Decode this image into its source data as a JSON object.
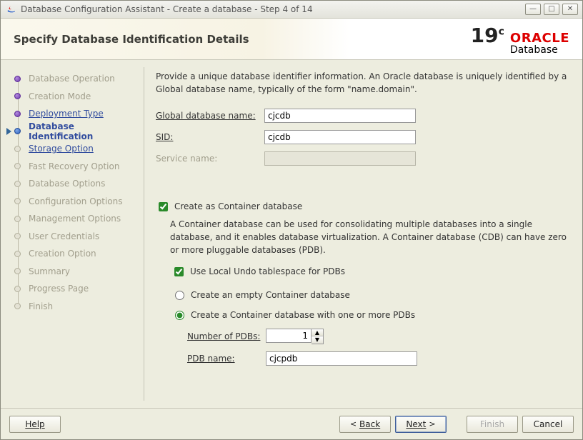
{
  "window": {
    "title": "Database Configuration Assistant - Create a database - Step 4 of 14"
  },
  "header": {
    "title": "Specify Database Identification Details",
    "brand_version": "19",
    "brand_suffix": "c",
    "brand_oracle": "ORACLE",
    "brand_db": "Database"
  },
  "steps": [
    {
      "label": "Database Operation",
      "state": "done"
    },
    {
      "label": "Creation Mode",
      "state": "done"
    },
    {
      "label": "Deployment Type",
      "state": "done_link"
    },
    {
      "label": "Database Identification",
      "state": "current"
    },
    {
      "label": "Storage Option",
      "state": "next_link"
    },
    {
      "label": "Fast Recovery Option",
      "state": "future"
    },
    {
      "label": "Database Options",
      "state": "future"
    },
    {
      "label": "Configuration Options",
      "state": "future"
    },
    {
      "label": "Management Options",
      "state": "future"
    },
    {
      "label": "User Credentials",
      "state": "future"
    },
    {
      "label": "Creation Option",
      "state": "future"
    },
    {
      "label": "Summary",
      "state": "future"
    },
    {
      "label": "Progress Page",
      "state": "future"
    },
    {
      "label": "Finish",
      "state": "future"
    }
  ],
  "content": {
    "intro": "Provide a unique database identifier information. An Oracle database is uniquely identified by a Global database name, typically of the form \"name.domain\".",
    "global_db_label": "Global database name:",
    "global_db_value": "cjcdb",
    "sid_label": "SID:",
    "sid_value": "cjcdb",
    "service_label": "Service name:",
    "service_value": "",
    "create_container_label": "Create as Container database",
    "container_desc": "A Container database can be used for consolidating multiple databases into a single database, and it enables database virtualization. A Container database (CDB) can have zero or more pluggable databases (PDB).",
    "use_local_undo_label": "Use Local Undo tablespace for PDBs",
    "create_empty_label": "Create an empty Container database",
    "create_with_pdbs_label": "Create a Container database with one or more PDBs",
    "num_pdbs_label": "Number of PDBs:",
    "num_pdbs_value": "1",
    "pdb_name_label": "PDB name:",
    "pdb_name_value": "cjcpdb"
  },
  "footer": {
    "help": "Help",
    "back": "Back",
    "next": "Next",
    "finish": "Finish",
    "cancel": "Cancel"
  }
}
